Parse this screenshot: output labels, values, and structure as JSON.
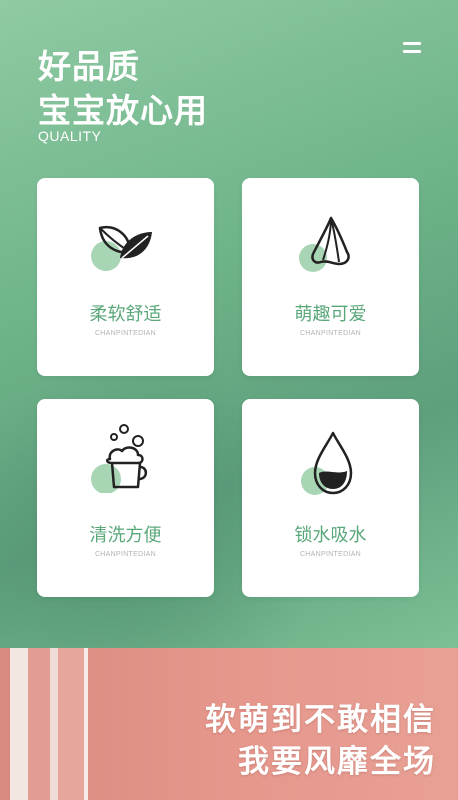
{
  "header": {
    "title_line1": "好品质",
    "title_line2": "宝宝放心用",
    "subtitle": "QUALITY",
    "menu_icon": "menu-icon"
  },
  "features": [
    {
      "label": "柔软舒适",
      "sub": "CHANPINTEDIAN",
      "icon": "leaf-icon"
    },
    {
      "label": "萌趣可爱",
      "sub": "CHANPINTEDIAN",
      "icon": "cloth-icon"
    },
    {
      "label": "清洗方便",
      "sub": "CHANPINTEDIAN",
      "icon": "bubble-bucket-icon"
    },
    {
      "label": "锁水吸水",
      "sub": "CHANPINTEDIAN",
      "icon": "water-drop-icon"
    }
  ],
  "banner": {
    "line1": "软萌到不敢相信",
    "line2": "我要风靡全场"
  },
  "colors": {
    "accent_green": "#5aa77a",
    "icon_circle": "#a8d5b4",
    "banner_pink": "#e6978c"
  }
}
